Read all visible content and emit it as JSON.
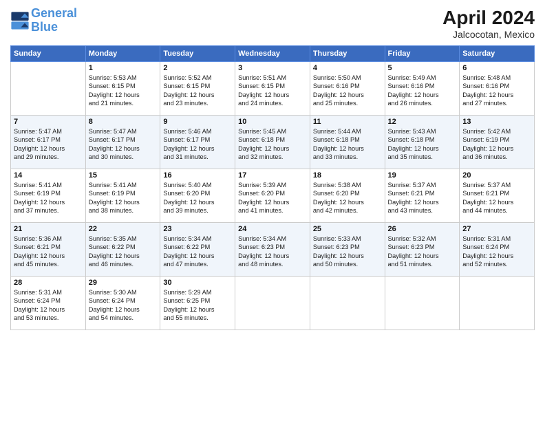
{
  "header": {
    "logo_line1": "General",
    "logo_line2": "Blue",
    "month": "April 2024",
    "location": "Jalcocotan, Mexico"
  },
  "days_of_week": [
    "Sunday",
    "Monday",
    "Tuesday",
    "Wednesday",
    "Thursday",
    "Friday",
    "Saturday"
  ],
  "weeks": [
    [
      {
        "day": "",
        "info": ""
      },
      {
        "day": "1",
        "info": "Sunrise: 5:53 AM\nSunset: 6:15 PM\nDaylight: 12 hours\nand 21 minutes."
      },
      {
        "day": "2",
        "info": "Sunrise: 5:52 AM\nSunset: 6:15 PM\nDaylight: 12 hours\nand 23 minutes."
      },
      {
        "day": "3",
        "info": "Sunrise: 5:51 AM\nSunset: 6:15 PM\nDaylight: 12 hours\nand 24 minutes."
      },
      {
        "day": "4",
        "info": "Sunrise: 5:50 AM\nSunset: 6:16 PM\nDaylight: 12 hours\nand 25 minutes."
      },
      {
        "day": "5",
        "info": "Sunrise: 5:49 AM\nSunset: 6:16 PM\nDaylight: 12 hours\nand 26 minutes."
      },
      {
        "day": "6",
        "info": "Sunrise: 5:48 AM\nSunset: 6:16 PM\nDaylight: 12 hours\nand 27 minutes."
      }
    ],
    [
      {
        "day": "7",
        "info": "Sunrise: 5:47 AM\nSunset: 6:17 PM\nDaylight: 12 hours\nand 29 minutes."
      },
      {
        "day": "8",
        "info": "Sunrise: 5:47 AM\nSunset: 6:17 PM\nDaylight: 12 hours\nand 30 minutes."
      },
      {
        "day": "9",
        "info": "Sunrise: 5:46 AM\nSunset: 6:17 PM\nDaylight: 12 hours\nand 31 minutes."
      },
      {
        "day": "10",
        "info": "Sunrise: 5:45 AM\nSunset: 6:18 PM\nDaylight: 12 hours\nand 32 minutes."
      },
      {
        "day": "11",
        "info": "Sunrise: 5:44 AM\nSunset: 6:18 PM\nDaylight: 12 hours\nand 33 minutes."
      },
      {
        "day": "12",
        "info": "Sunrise: 5:43 AM\nSunset: 6:18 PM\nDaylight: 12 hours\nand 35 minutes."
      },
      {
        "day": "13",
        "info": "Sunrise: 5:42 AM\nSunset: 6:19 PM\nDaylight: 12 hours\nand 36 minutes."
      }
    ],
    [
      {
        "day": "14",
        "info": "Sunrise: 5:41 AM\nSunset: 6:19 PM\nDaylight: 12 hours\nand 37 minutes."
      },
      {
        "day": "15",
        "info": "Sunrise: 5:41 AM\nSunset: 6:19 PM\nDaylight: 12 hours\nand 38 minutes."
      },
      {
        "day": "16",
        "info": "Sunrise: 5:40 AM\nSunset: 6:20 PM\nDaylight: 12 hours\nand 39 minutes."
      },
      {
        "day": "17",
        "info": "Sunrise: 5:39 AM\nSunset: 6:20 PM\nDaylight: 12 hours\nand 41 minutes."
      },
      {
        "day": "18",
        "info": "Sunrise: 5:38 AM\nSunset: 6:20 PM\nDaylight: 12 hours\nand 42 minutes."
      },
      {
        "day": "19",
        "info": "Sunrise: 5:37 AM\nSunset: 6:21 PM\nDaylight: 12 hours\nand 43 minutes."
      },
      {
        "day": "20",
        "info": "Sunrise: 5:37 AM\nSunset: 6:21 PM\nDaylight: 12 hours\nand 44 minutes."
      }
    ],
    [
      {
        "day": "21",
        "info": "Sunrise: 5:36 AM\nSunset: 6:21 PM\nDaylight: 12 hours\nand 45 minutes."
      },
      {
        "day": "22",
        "info": "Sunrise: 5:35 AM\nSunset: 6:22 PM\nDaylight: 12 hours\nand 46 minutes."
      },
      {
        "day": "23",
        "info": "Sunrise: 5:34 AM\nSunset: 6:22 PM\nDaylight: 12 hours\nand 47 minutes."
      },
      {
        "day": "24",
        "info": "Sunrise: 5:34 AM\nSunset: 6:23 PM\nDaylight: 12 hours\nand 48 minutes."
      },
      {
        "day": "25",
        "info": "Sunrise: 5:33 AM\nSunset: 6:23 PM\nDaylight: 12 hours\nand 50 minutes."
      },
      {
        "day": "26",
        "info": "Sunrise: 5:32 AM\nSunset: 6:23 PM\nDaylight: 12 hours\nand 51 minutes."
      },
      {
        "day": "27",
        "info": "Sunrise: 5:31 AM\nSunset: 6:24 PM\nDaylight: 12 hours\nand 52 minutes."
      }
    ],
    [
      {
        "day": "28",
        "info": "Sunrise: 5:31 AM\nSunset: 6:24 PM\nDaylight: 12 hours\nand 53 minutes."
      },
      {
        "day": "29",
        "info": "Sunrise: 5:30 AM\nSunset: 6:24 PM\nDaylight: 12 hours\nand 54 minutes."
      },
      {
        "day": "30",
        "info": "Sunrise: 5:29 AM\nSunset: 6:25 PM\nDaylight: 12 hours\nand 55 minutes."
      },
      {
        "day": "",
        "info": ""
      },
      {
        "day": "",
        "info": ""
      },
      {
        "day": "",
        "info": ""
      },
      {
        "day": "",
        "info": ""
      }
    ]
  ]
}
